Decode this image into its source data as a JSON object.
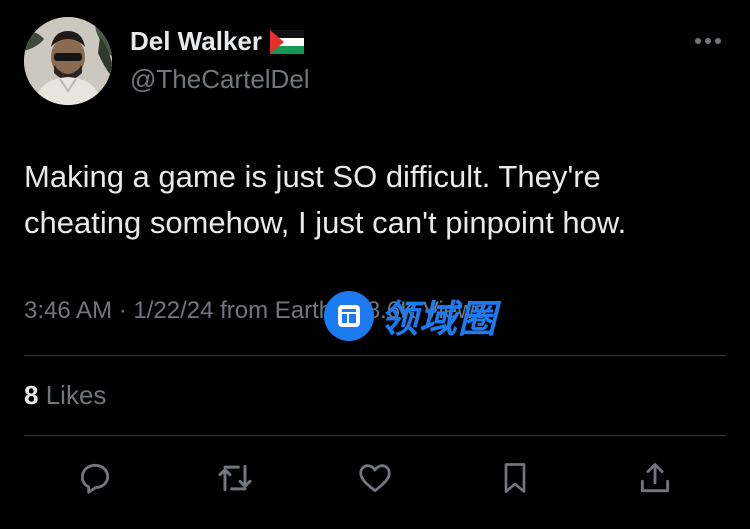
{
  "author": {
    "display_name": "Del Walker",
    "handle": "@TheCartelDel",
    "flag_icon": "palestine-flag-icon"
  },
  "tweet": {
    "lines": [
      "Making a game is just SO difficult. They're",
      "cheating somehow, I just can't pinpoint how."
    ],
    "meta": "3:46 AM · 1/22/24 from Earth · 18.6K Views"
  },
  "engagement": {
    "likes_count": "8",
    "likes_label": "Likes"
  },
  "actions": [
    "reply-icon",
    "retweet-icon",
    "like-icon",
    "bookmark-icon",
    "share-icon"
  ],
  "watermark": {
    "text": "领域圈"
  },
  "colors": {
    "background": "#000000",
    "primary_text": "#e7e9ea",
    "secondary_text": "#71767b",
    "divider": "#2f3336",
    "watermark": "#1d7bf2"
  }
}
